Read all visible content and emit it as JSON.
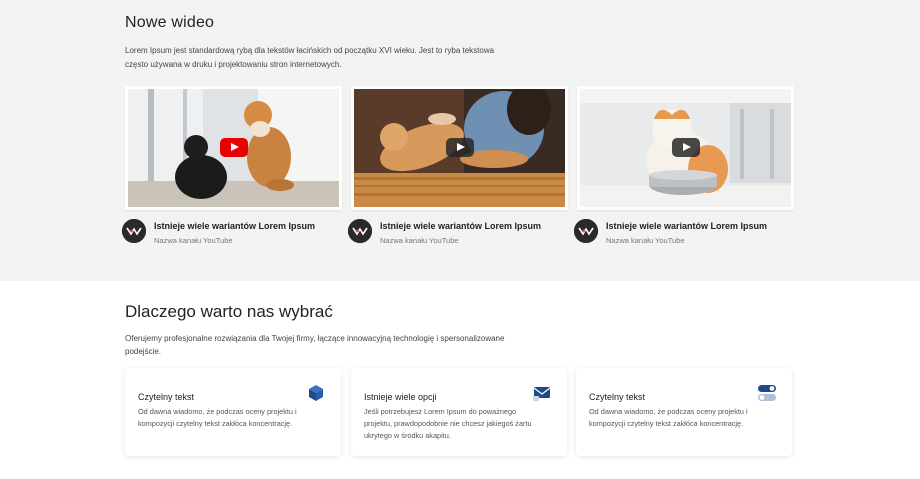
{
  "videos": {
    "heading": "Nowe wideo",
    "description": "Lorem Ipsum jest standardową rybą dla tekstów łacińskich od początku XVI wieku. Jest to ryba tekstowa często używana w druku i projektowaniu stron internetowych.",
    "items": [
      {
        "title": "Istnieje wiele wariantów Lorem Ipsum",
        "channel": "Nazwa kanału YouTube"
      },
      {
        "title": "Istnieje wiele wariantów Lorem Ipsum",
        "channel": "Nazwa kanału YouTube"
      },
      {
        "title": "Istnieje wiele wariantów Lorem Ipsum",
        "channel": "Nazwa kanału YouTube"
      }
    ]
  },
  "why": {
    "heading": "Dlaczego warto nas wybrać",
    "description": "Oferujemy profesjonalne rozwiązania dla Twojej firmy, łączące innowacyjną technologię i spersonalizowane podejście.",
    "features": [
      {
        "title": "Czytelny tekst",
        "text": "Od dawna wiadomo, że podczas oceny projektu i kompozycji czytelny tekst zakłóca koncentrację.",
        "icon": "cube-icon"
      },
      {
        "title": "Istnieje wiele opcji",
        "text": "Jeśli potrzebujesz Lorem Ipsum do poważnego projektu, prawdopodobnie nie chcesz jakiegoś żartu ukrytego w środku akapitu.",
        "icon": "mail-icon"
      },
      {
        "title": "Czytelny tekst",
        "text": "Od dawna wiadomo, że podczas oceny projektu i kompozycji czytelny tekst zakłóca koncentrację.",
        "icon": "toggle-icon"
      }
    ]
  },
  "colors": {
    "accent": "#1e4a8c",
    "youtube_red": "#e60000",
    "section_bg": "#f3f3f3"
  }
}
